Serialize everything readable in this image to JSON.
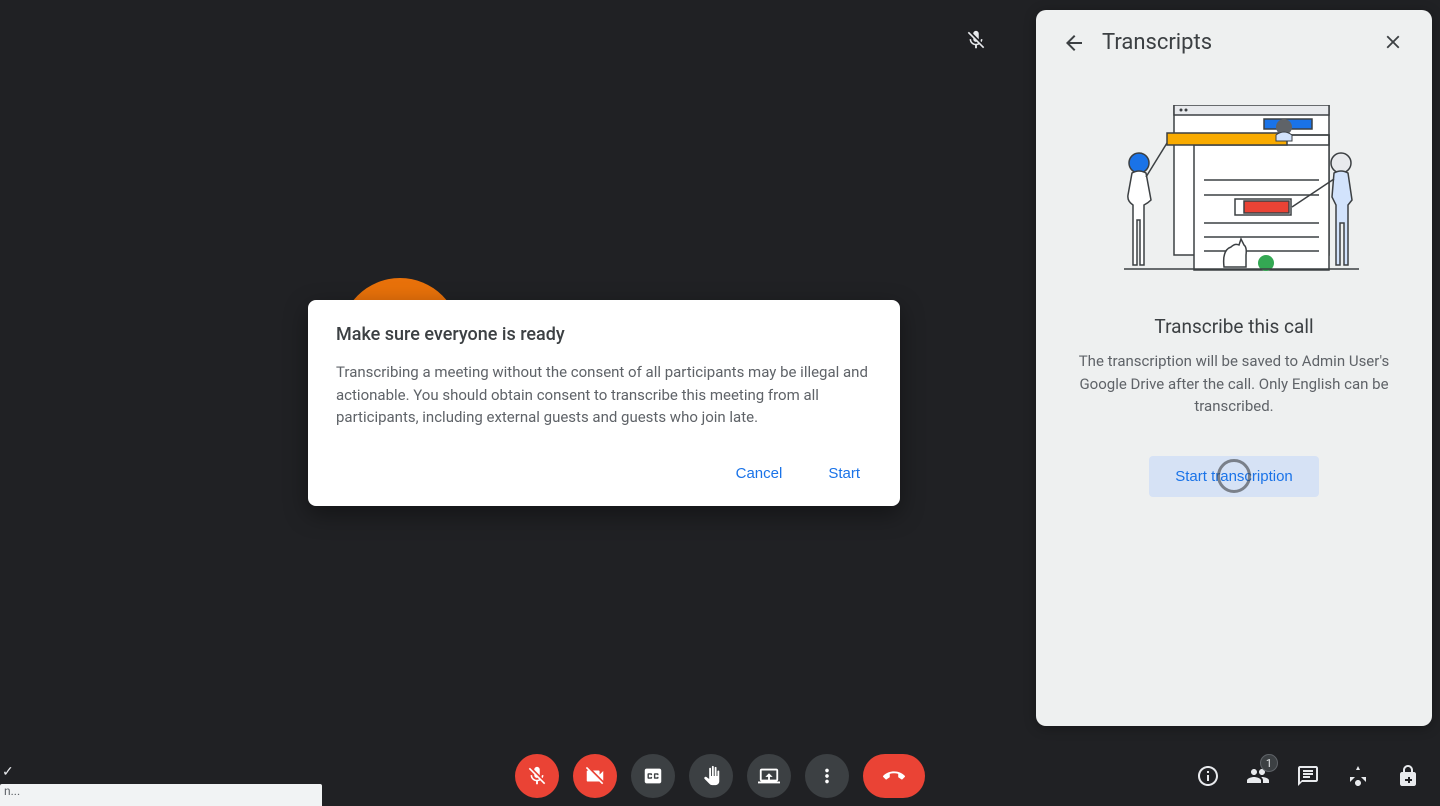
{
  "dialog": {
    "title": "Make sure everyone is ready",
    "body": "Transcribing a meeting without the consent of all participants may be illegal and actionable. You should obtain consent to transcribe this meeting from all participants, including external guests and guests who join late.",
    "cancel": "Cancel",
    "start": "Start"
  },
  "panel": {
    "title": "Transcripts",
    "heading": "Transcribe this call",
    "description": "The transcription will be saved to Admin User's Google Drive after the call. Only English can be transcribed.",
    "button": "Start transcription"
  },
  "bottom": {
    "participant_count": "1",
    "truncated_text": "n..."
  }
}
